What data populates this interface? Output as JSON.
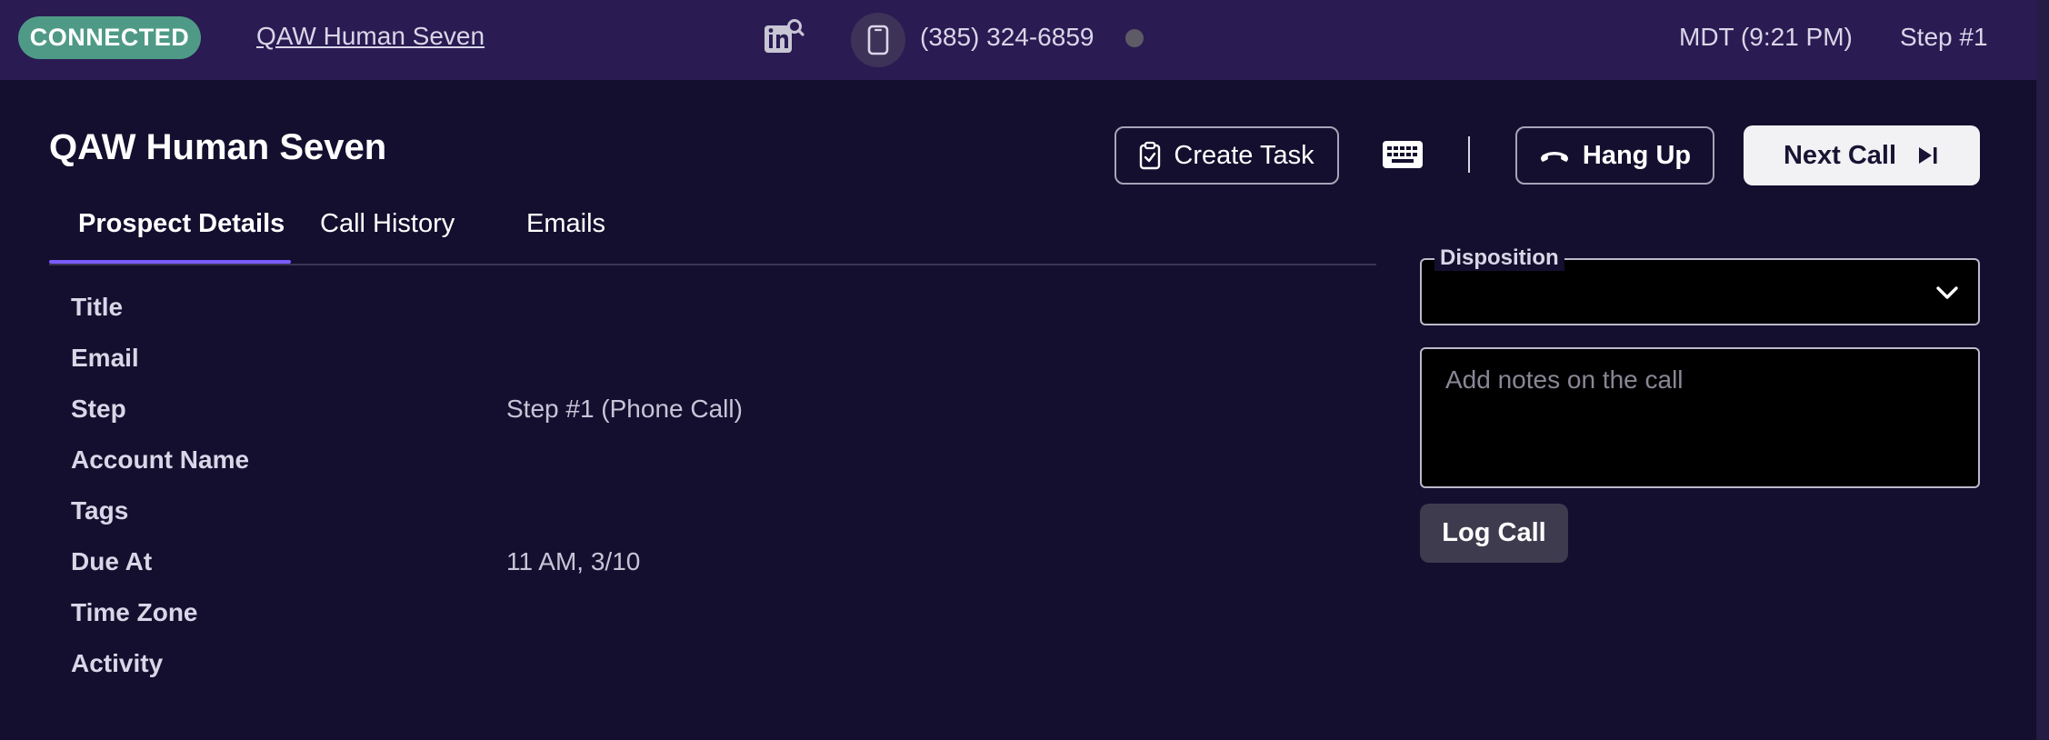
{
  "topbar": {
    "status": "CONNECTED",
    "prospect_name": "QAW Human Seven",
    "phone_number": "(385) 324-6859",
    "timezone": "MDT (9:21 PM)",
    "step": "Step #1"
  },
  "header": {
    "title": "QAW Human Seven",
    "create_task_label": "Create Task",
    "hang_up_label": "Hang Up",
    "next_call_label": "Next Call"
  },
  "tabs": [
    {
      "label": "Prospect Details",
      "active": true
    },
    {
      "label": "Call History",
      "active": false
    },
    {
      "label": "Emails",
      "active": false
    }
  ],
  "details": [
    {
      "label": "Title",
      "value": ""
    },
    {
      "label": "Email",
      "value": ""
    },
    {
      "label": "Step",
      "value": "Step #1 (Phone Call)"
    },
    {
      "label": "Account Name",
      "value": ""
    },
    {
      "label": "Tags",
      "value": ""
    },
    {
      "label": "Due At",
      "value": "11 AM, 3/10"
    },
    {
      "label": "Time Zone",
      "value": ""
    },
    {
      "label": "Activity",
      "value": ""
    }
  ],
  "call_panel": {
    "disposition_label": "Disposition",
    "disposition_value": "",
    "notes_placeholder": "Add notes on the call",
    "notes_value": "",
    "log_call_label": "Log Call"
  },
  "colors": {
    "connected_badge": "#4f9a86",
    "topbar_bg": "#2a1b53",
    "page_bg": "#140f2e",
    "tab_accent": "#7b5cff"
  },
  "icons": [
    "linkedin-search-icon",
    "mobile-phone-icon",
    "clipboard-check-icon",
    "keyboard-icon",
    "hang-up-icon",
    "skip-next-icon",
    "chevron-down-icon"
  ]
}
